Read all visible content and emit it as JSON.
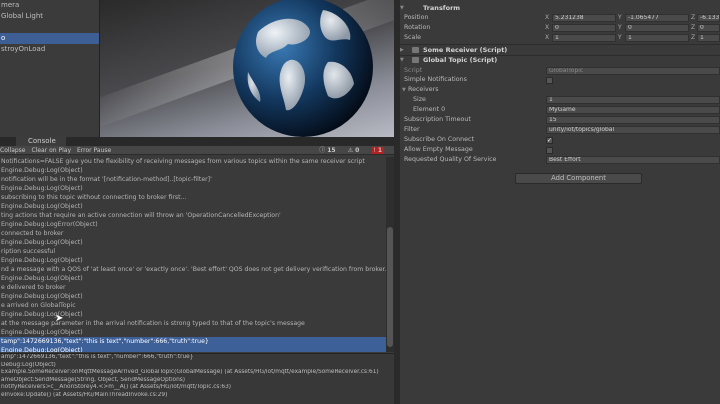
{
  "hierarchy": {
    "items": [
      {
        "label": "mera",
        "selected": false
      },
      {
        "label": "Global Light",
        "selected": false
      },
      {
        "label": "",
        "selected": false
      },
      {
        "label": "o",
        "selected": true
      },
      {
        "label": "stroyOnLoad",
        "selected": false
      }
    ]
  },
  "console": {
    "tab_label": "Console",
    "toolbar": [
      "Collapse",
      "Clear on Play",
      "Error Pause"
    ],
    "counts": {
      "log": "15",
      "warn": "0",
      "error": "1"
    },
    "logs": [
      {
        "line1": "Notifications=FALSE give you the flexibility of receiving messages from various topics within the same receiver script",
        "line2": "Engine.Debug:Log(Object)"
      },
      {
        "line1": "notification will be in the format '[notification-method]..[topic-filter]'",
        "line2": "Engine.Debug:Log(Object)"
      },
      {
        "line1": "subscribing to this topic without connecting to broker first...",
        "line2": "Engine.Debug:Log(Object)"
      },
      {
        "line1": "ting actions that require an active connection will throw an 'OperationCancelledException'",
        "line2": "Engine.Debug:LogError(Object)"
      },
      {
        "line1": "connected to broker",
        "line2": "Engine.Debug:Log(Object)"
      },
      {
        "line1": "ription successful",
        "line2": "Engine.Debug:Log(Object)"
      },
      {
        "line1": "nd a message with a QOS of 'at least once' or 'exactly once'. 'Best effort' QOS does not get delivery verification from broker.  'Best",
        "line2": "Engine.Debug:Log(Object)"
      },
      {
        "line1": "e delivered to broker",
        "line2": "Engine.Debug:Log(Object)"
      },
      {
        "line1": "e arrived on GlobalTopic",
        "line2": "Engine.Debug:Log(Object)"
      },
      {
        "line1": "at the message parameter in the arrival notification is strong typed to that of the topic's message",
        "line2": "Engine.Debug:Log(Object)"
      },
      {
        "line1": "tamp\":1472669136,\"text\":\"this is text\",\"number\":666,\"truth\":true}",
        "line2": "Engine.Debug:Log(Object)",
        "selected": true
      }
    ],
    "detail": [
      "amp\":1472669136,\"text\":\"this is text\",\"number\":666,\"truth\":true}",
      "Debug:Log(Object)",
      "Example.SomeReceiver:onMqttMessageArrived_GlobalTopic(GlobalMessage) (at Assets/HG/iot/mqtt/example/SomeReceiver.cs:61)",
      "ameObject:SendMessage(String, Object, SendMessageOptions)",
      "notifyReceivers>c__AnonStorey4.<>m__A() (at Assets/HG/iot/mqtt/Topic.cs:63)",
      "eInvoke:Update() (at Assets/HG/MainThreadInvoke.cs:29)"
    ]
  },
  "inspector": {
    "transform_title": "Transform",
    "position": {
      "label": "Position",
      "x": "5.231238",
      "y": "-1.065477",
      "z": "-6.1334"
    },
    "rotation": {
      "label": "Rotation",
      "x": "0",
      "y": "0",
      "z": "0"
    },
    "scale": {
      "label": "Scale",
      "x": "1",
      "y": "1",
      "z": "1"
    },
    "comp1": "Some Receiver (Script)",
    "comp2": "Global Topic (Script)",
    "script": {
      "label": "Script",
      "value": "GlobalTopic"
    },
    "simple_notifications": {
      "label": "Simple Notifications"
    },
    "receivers": {
      "label": "Receivers"
    },
    "size": {
      "label": "Size",
      "value": "1"
    },
    "element0": {
      "label": "Element 0",
      "value": "MyGame"
    },
    "sub_timeout": {
      "label": "Subscription Timeout",
      "value": "15"
    },
    "filter": {
      "label": "Filter",
      "value": "unity/iot/topics/global"
    },
    "subscribe_on_connect": {
      "label": "Subscribe On Connect",
      "check": "✓"
    },
    "allow_empty": {
      "label": "Allow Empty Message"
    },
    "qos": {
      "label": "Requested Quality Of Service",
      "value": "Best Effort"
    },
    "add_component": "Add Component",
    "axis": {
      "x": "X",
      "y": "Y",
      "z": "Z"
    }
  },
  "colors": {
    "selection": "#3d6099",
    "background": "#383838",
    "error_badge": "#b12222"
  }
}
